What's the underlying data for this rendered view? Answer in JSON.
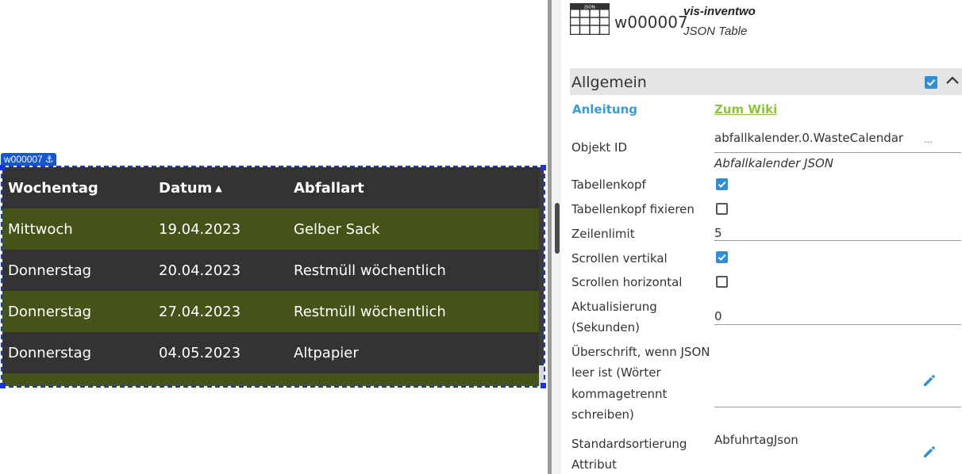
{
  "canvas": {
    "widget_tag": "w000007",
    "table": {
      "headers": [
        "Wochentag",
        "Datum",
        "Abfallart"
      ],
      "sort_indicator": "▲",
      "rows": [
        [
          "Mittwoch",
          "19.04.2023",
          "Gelber Sack"
        ],
        [
          "Donnerstag",
          "20.04.2023",
          "Restmüll wöchentlich"
        ],
        [
          "Donnerstag",
          "27.04.2023",
          "Restmüll wöchentlich"
        ],
        [
          "Donnerstag",
          "04.05.2023",
          "Altpapier"
        ]
      ]
    },
    "colors": {
      "header_bg": "#333333",
      "row_accent": "#445419",
      "row_dark": "#333333",
      "selection": "#1a33e0"
    }
  },
  "properties": {
    "widget": {
      "icon_label": "JSON",
      "id": "w000007",
      "set": "vis-inventwo",
      "type": "JSON Table"
    },
    "group": {
      "title": "Allgemein",
      "enabled": true
    },
    "fields": {
      "anleitung_label": "Anleitung",
      "wiki_link": "Zum Wiki",
      "objekt_id_label": "Objekt ID",
      "objekt_id_value": "abfallkalender.0.WasteCalendar",
      "objekt_id_dots": "...",
      "objekt_id_name": "Abfallkalender JSON",
      "tabellenkopf_label": "Tabellenkopf",
      "tabellenkopf_checked": true,
      "tabellenkopf_fix_label": "Tabellenkopf fixieren",
      "tabellenkopf_fix_checked": false,
      "zeilenlimit_label": "Zeilenlimit",
      "zeilenlimit_value": "5",
      "scroll_v_label": "Scrollen vertikal",
      "scroll_v_checked": true,
      "scroll_h_label": "Scrollen horizontal",
      "scroll_h_checked": false,
      "aktualisierung_label_1": "Aktualisierung",
      "aktualisierung_label_2": "(Sekunden)",
      "aktualisierung_value": "0",
      "ueberschrift_label_1": "Überschrift, wenn JSON",
      "ueberschrift_label_2": "leer ist (Wörter",
      "ueberschrift_label_3": "kommagetrennt",
      "ueberschrift_label_4": "schreiben)",
      "ueberschrift_value": "",
      "sortierung_label_1": "Standardsortierung",
      "sortierung_label_2": "Attribut",
      "sortierung_value": "AbfuhrtagJson"
    },
    "colors": {
      "accent": "#2f8fd6",
      "link": "#3b9bd8",
      "wiki": "#8cc43c"
    }
  }
}
